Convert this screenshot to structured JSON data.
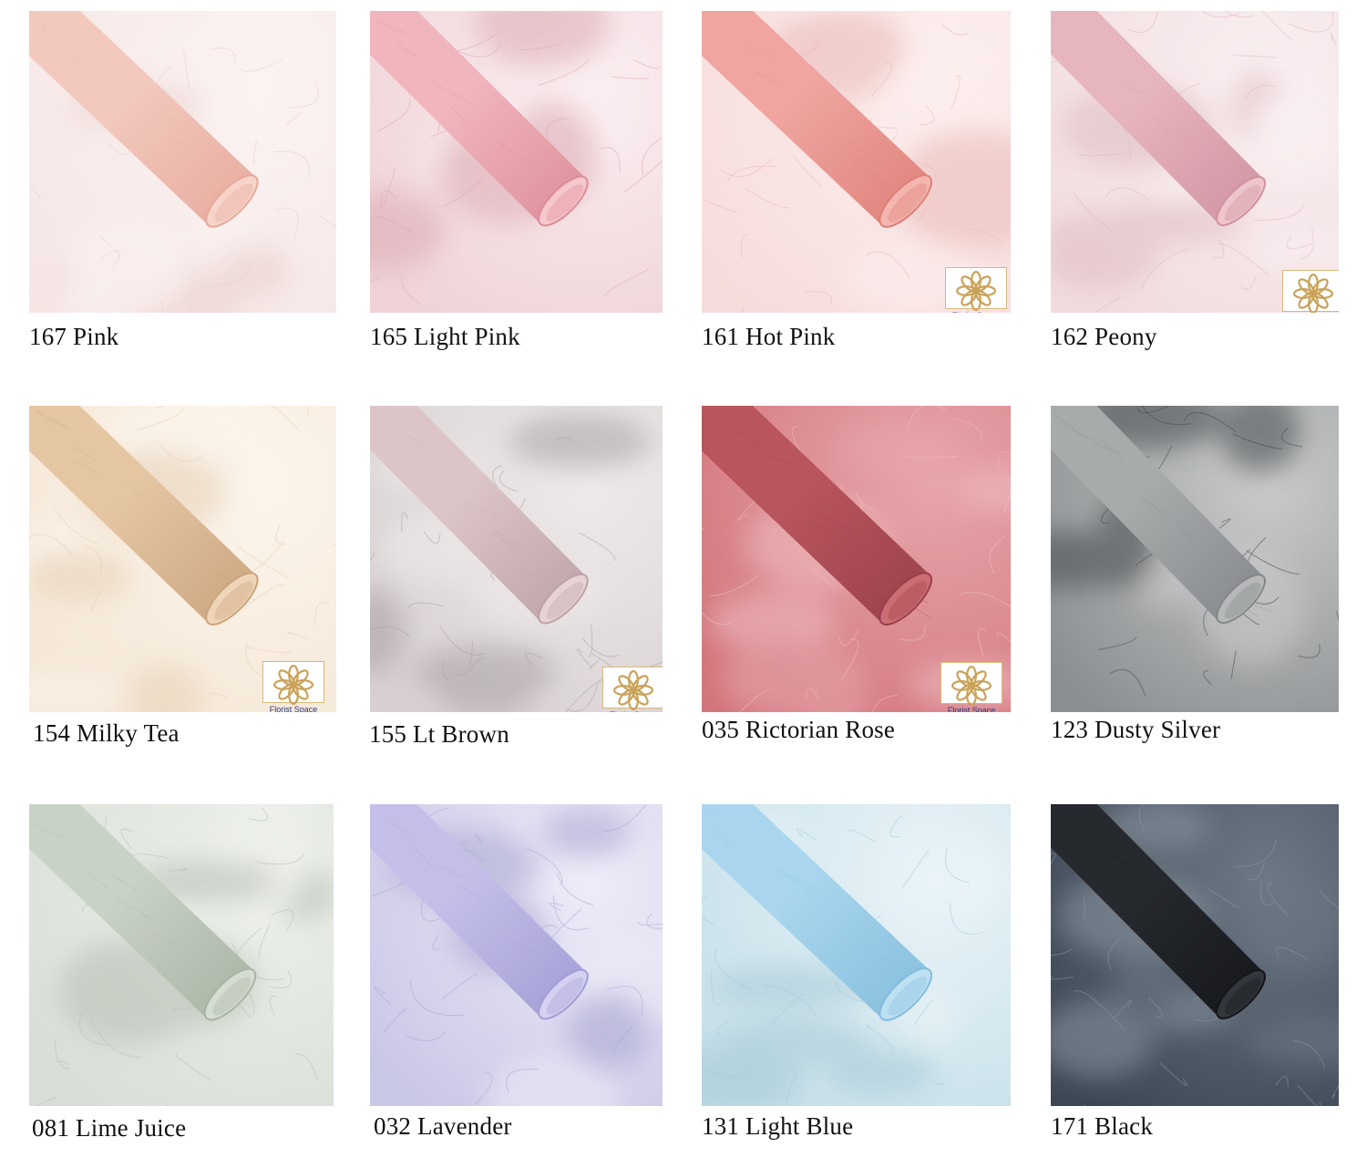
{
  "swatches": [
    {
      "label": "167 Pink",
      "colors": {
        "base": "#f6e7e6",
        "light": "#fbf3f2",
        "roll": "#f3c9be",
        "rollShade": "#e6aa9c",
        "rollEnd": "#f7d4ca",
        "vein": "#e8cfcc"
      },
      "logo": false
    },
    {
      "label": "165 Light Pink",
      "colors": {
        "base": "#efd3d8",
        "light": "#fbeff1",
        "roll": "#f1b5bd",
        "rollShade": "#dc8d99",
        "rollEnd": "#f6c7cd",
        "vein": "#dcaab3"
      },
      "logo": false
    },
    {
      "label": "161 Hot Pink",
      "colors": {
        "base": "#f7dcdc",
        "light": "#fcefee",
        "roll": "#f0a5a0",
        "rollShade": "#dd8078",
        "rollEnd": "#f4b6b0",
        "vein": "#e9b9b6"
      },
      "logo": true
    },
    {
      "label": "162 Peony",
      "colors": {
        "base": "#f1dcdf",
        "light": "#faf0f1",
        "roll": "#e7b5be",
        "rollShade": "#cf92a0",
        "rollEnd": "#eec5cb",
        "vein": "#dfbcc2"
      },
      "logo": true
    },
    {
      "label": "154 Milky Tea",
      "colors": {
        "base": "#f5e7d6",
        "light": "#fcf5ec",
        "roll": "#e5c6a3",
        "rollShade": "#c9a47d",
        "rollEnd": "#eed5b8",
        "vein": "#e6d0b6"
      },
      "logo": true
    },
    {
      "label": "155 Lt Brown",
      "colors": {
        "base": "#d8d0d1",
        "light": "#efeaea",
        "roll": "#dcc5c8",
        "rollShade": "#bca2a7",
        "rollEnd": "#e6d3d6",
        "vein": "#a8a0a2"
      },
      "logo": true
    },
    {
      "label": "035 Rictorian Rose",
      "colors": {
        "base": "#d2757c",
        "light": "#e7a6ab",
        "roll": "#b9555e",
        "rollShade": "#98404a",
        "rollEnd": "#cc6d74",
        "vein": "#f0c0c3"
      },
      "logo": true
    },
    {
      "label": "123 Dusty Silver",
      "colors": {
        "base": "#8c8f91",
        "light": "#c9cbcc",
        "roll": "#a8abac",
        "rollShade": "#84878a",
        "rollEnd": "#b6b8b9",
        "vein": "#45494c"
      },
      "logo": false
    },
    {
      "label": "081 Lime Juice",
      "colors": {
        "base": "#d8ded6",
        "light": "#eef1ec",
        "roll": "#c9d2c6",
        "rollShade": "#a8b3a3",
        "rollEnd": "#d5ddd2",
        "vein": "#b6beb2"
      },
      "logo": false
    },
    {
      "label": "032 Lavender",
      "colors": {
        "base": "#c9c7e6",
        "light": "#eeedf8",
        "roll": "#c3bfe9",
        "rollShade": "#a29dd4",
        "rollEnd": "#d4d1f1",
        "vein": "#a9a6d1"
      },
      "logo": false
    },
    {
      "label": "131 Light Blue",
      "colors": {
        "base": "#c5dfe9",
        "light": "#eaf4f8",
        "roll": "#a9d6ee",
        "rollShade": "#84bcdc",
        "rollEnd": "#bde0f3",
        "vein": "#a6c9d6"
      },
      "logo": false
    },
    {
      "label": "171 Black",
      "colors": {
        "base": "#3d4754",
        "light": "#6d7885",
        "roll": "#26292e",
        "rollShade": "#14161a",
        "rollEnd": "#33373d",
        "vein": "#8d97a3"
      },
      "logo": false
    }
  ],
  "logo": {
    "text": "Florist Space",
    "colors": {
      "mark": "#c9a35a",
      "text": "#2b3a7a",
      "border": "#d9b778"
    },
    "icon": "mandala-logo-icon"
  }
}
